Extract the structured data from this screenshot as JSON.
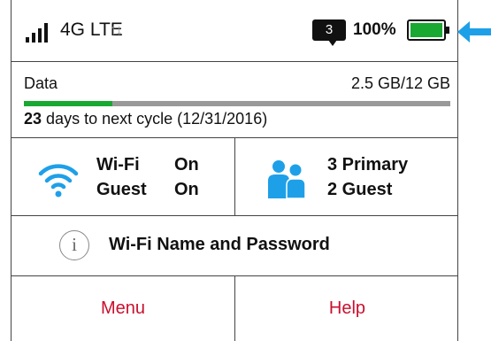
{
  "status_bar": {
    "network_type": "4G LTE",
    "activity_arrows": "↑↓",
    "message_count": "3",
    "battery_percent": "100%",
    "battery_level": 1.0,
    "signal_bars": 4
  },
  "data_usage": {
    "label": "Data",
    "amount": "2.5 GB/12 GB",
    "used_fraction": 0.208,
    "days_remaining": "23",
    "cycle_text": "days to next cycle (12/31/2016)"
  },
  "wifi": {
    "wifi_label": "Wi-Fi",
    "wifi_state": "On",
    "guest_label": "Guest",
    "guest_state": "On"
  },
  "devices": {
    "primary": "3 Primary",
    "guest": "2 Guest"
  },
  "wifi_name": {
    "info_glyph": "i",
    "label": "Wi-Fi Name and Password"
  },
  "menu": {
    "menu_label": "Menu",
    "help_label": "Help"
  },
  "colors": {
    "accent_red": "#c8102e",
    "battery_green": "#19a832",
    "icon_blue": "#1ea0e8"
  }
}
